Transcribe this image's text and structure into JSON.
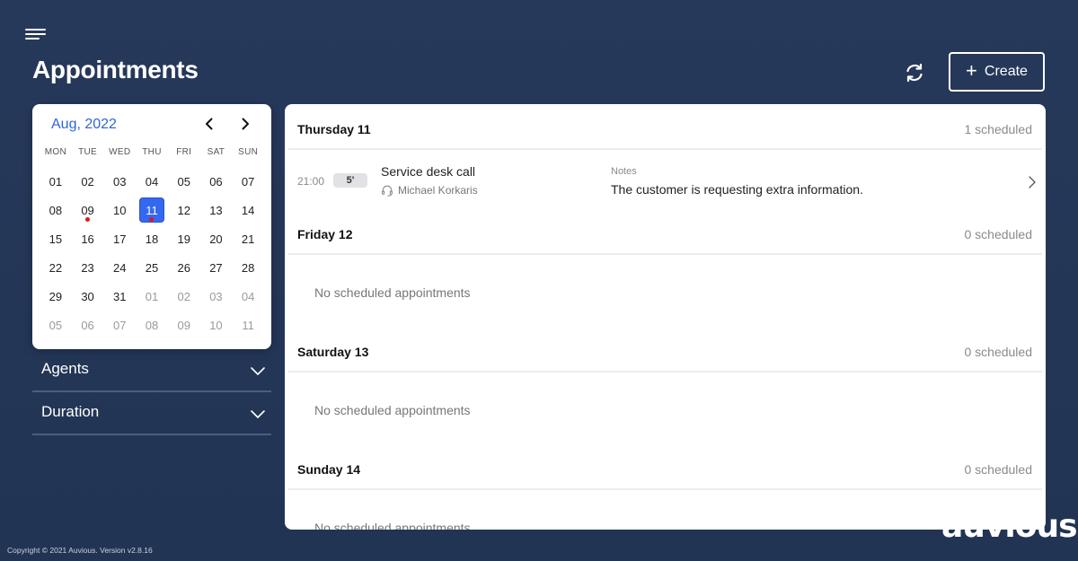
{
  "header": {
    "title": "Appointments",
    "menu_icon": "hamburger-icon",
    "refresh_icon": "refresh-icon",
    "create_label": "Create",
    "create_icon": "plus-icon"
  },
  "calendar": {
    "month_label": "Aug, 2022",
    "prev_icon": "chevron-left-icon",
    "next_icon": "chevron-right-icon",
    "weekdays": [
      "MON",
      "TUE",
      "WED",
      "THU",
      "FRI",
      "SAT",
      "SUN"
    ],
    "selected_day": "11",
    "weeks": [
      [
        {
          "d": "01"
        },
        {
          "d": "02"
        },
        {
          "d": "03"
        },
        {
          "d": "04"
        },
        {
          "d": "05"
        },
        {
          "d": "06"
        },
        {
          "d": "07"
        }
      ],
      [
        {
          "d": "08"
        },
        {
          "d": "09",
          "dot": true
        },
        {
          "d": "10"
        },
        {
          "d": "11",
          "selected": true,
          "dot": true
        },
        {
          "d": "12"
        },
        {
          "d": "13"
        },
        {
          "d": "14"
        }
      ],
      [
        {
          "d": "15"
        },
        {
          "d": "16"
        },
        {
          "d": "17"
        },
        {
          "d": "18"
        },
        {
          "d": "19"
        },
        {
          "d": "20"
        },
        {
          "d": "21"
        }
      ],
      [
        {
          "d": "22"
        },
        {
          "d": "23"
        },
        {
          "d": "24"
        },
        {
          "d": "25"
        },
        {
          "d": "26"
        },
        {
          "d": "27"
        },
        {
          "d": "28"
        }
      ],
      [
        {
          "d": "29"
        },
        {
          "d": "30"
        },
        {
          "d": "31"
        },
        {
          "d": "01",
          "muted": true
        },
        {
          "d": "02",
          "muted": true
        },
        {
          "d": "03",
          "muted": true
        },
        {
          "d": "04",
          "muted": true
        }
      ],
      [
        {
          "d": "05",
          "muted": true
        },
        {
          "d": "06",
          "muted": true
        },
        {
          "d": "07",
          "muted": true
        },
        {
          "d": "08",
          "muted": true
        },
        {
          "d": "09",
          "muted": true
        },
        {
          "d": "10",
          "muted": true
        },
        {
          "d": "11",
          "muted": true
        }
      ]
    ],
    "colors": {
      "accent": "#3468f0",
      "dot": "#e8141b",
      "month": "#2f63e0"
    }
  },
  "filters": [
    {
      "label": "Agents",
      "icon": "chevron-down-icon"
    },
    {
      "label": "Duration",
      "icon": "chevron-down-icon"
    }
  ],
  "days": [
    {
      "name": "Thursday 11",
      "count": "1 scheduled",
      "appointments": [
        {
          "time": "21:00",
          "duration": "5'",
          "title": "Service desk call",
          "agent": "Michael Korkaris",
          "agent_icon": "headset-icon",
          "notes_label": "Notes",
          "notes": "The customer is requesting extra information."
        }
      ]
    },
    {
      "name": "Friday 12",
      "count": "0 scheduled",
      "empty": "No scheduled appointments"
    },
    {
      "name": "Saturday 13",
      "count": "0 scheduled",
      "empty": "No scheduled appointments"
    },
    {
      "name": "Sunday 14",
      "count": "0 scheduled",
      "empty": "No scheduled appointments"
    }
  ],
  "footer": {
    "copyright": "Copyright © 2021 Auvious. Version v2.8.16",
    "logo": "auvious"
  },
  "colors": {
    "background": "#243757",
    "panel": "#ffffff"
  }
}
